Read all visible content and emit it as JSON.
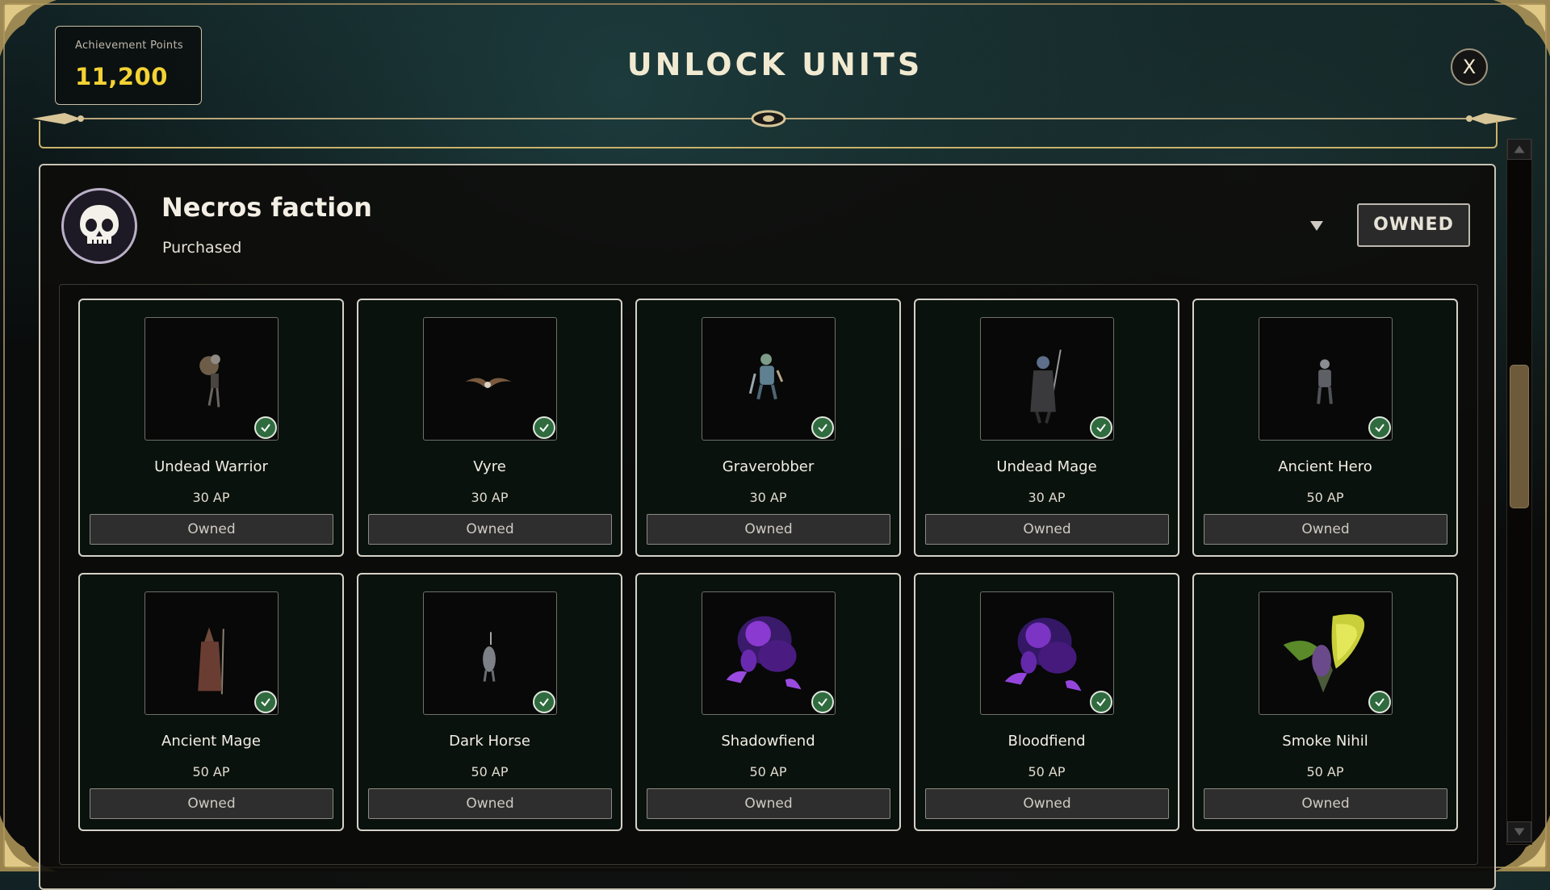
{
  "header": {
    "ap_label": "Achievement Points",
    "ap_value": "11,200",
    "title": "UNLOCK UNITS",
    "close_label": "X"
  },
  "faction": {
    "name": "Necros faction",
    "status": "Purchased",
    "badge": "OWNED",
    "icon": "skull-icon"
  },
  "units": [
    {
      "name": "Undead Warrior",
      "cost": "30 AP",
      "button": "Owned"
    },
    {
      "name": "Vyre",
      "cost": "30 AP",
      "button": "Owned"
    },
    {
      "name": "Graverobber",
      "cost": "30 AP",
      "button": "Owned"
    },
    {
      "name": "Undead Mage",
      "cost": "30 AP",
      "button": "Owned"
    },
    {
      "name": "Ancient Hero",
      "cost": "50 AP",
      "button": "Owned"
    },
    {
      "name": "Ancient Mage",
      "cost": "50 AP",
      "button": "Owned"
    },
    {
      "name": "Dark Horse",
      "cost": "50 AP",
      "button": "Owned"
    },
    {
      "name": "Shadowfiend",
      "cost": "50 AP",
      "button": "Owned"
    },
    {
      "name": "Bloodfiend",
      "cost": "50 AP",
      "button": "Owned"
    },
    {
      "name": "Smoke Nihil",
      "cost": "50 AP",
      "button": "Owned"
    }
  ],
  "colors": {
    "accent_gold": "#f3d234",
    "check_green": "#2f6b3e",
    "frame_gold": "#c9b26a"
  }
}
